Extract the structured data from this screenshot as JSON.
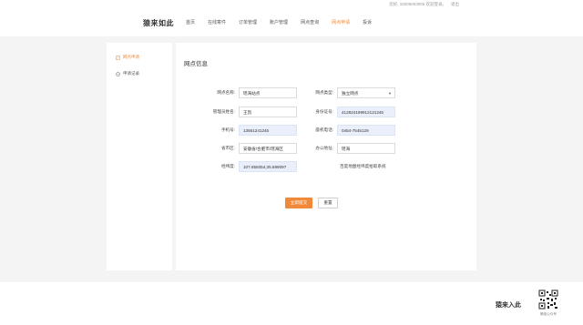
{
  "topbar": {
    "greeting": "您好, 15005003006 欢迎登录。",
    "logout": "退出"
  },
  "header": {
    "logo": "猿来如此",
    "nav": [
      {
        "label": "首页",
        "active": false
      },
      {
        "label": "在线寄件",
        "active": false
      },
      {
        "label": "订单管理",
        "active": false
      },
      {
        "label": "账户管理",
        "active": false
      },
      {
        "label": "网点查询",
        "active": false
      },
      {
        "label": "网点申请",
        "active": true
      },
      {
        "label": "投诉",
        "active": false
      }
    ]
  },
  "sidebar": {
    "items": [
      {
        "label": "网点申请",
        "icon": "edit-icon",
        "active": true
      },
      {
        "label": "申请记录",
        "icon": "check-circle-icon",
        "active": false
      }
    ]
  },
  "main": {
    "title": "网点信息",
    "fields": {
      "outlet_name": {
        "label": "网点名称:",
        "value": "瑶海站点"
      },
      "outlet_type": {
        "label": "网点类型:",
        "value": "独立网点"
      },
      "manager_name": {
        "label": "管理员姓名:",
        "value": "王凯"
      },
      "id_number": {
        "label": "身份证号:",
        "value": "412824199912121245"
      },
      "phone": {
        "label": "手机号:",
        "value": "13561241245"
      },
      "landline": {
        "label": "座机电话:",
        "value": "0454-7545129"
      },
      "region": {
        "label": "省市区:",
        "value": "安徽省/合肥市/瑶海区"
      },
      "office_address": {
        "label": "办公地址:",
        "value": "瑶海"
      },
      "coords": {
        "label": "经纬度:",
        "value": "107.655054,35.699097"
      },
      "coords_hint": "百度地图经纬度拾取系统"
    },
    "submit_label": "立即提交",
    "reset_label": "重置"
  },
  "footer": {
    "logo": "猿来入此",
    "qr_caption": "微信公众号"
  },
  "colors": {
    "accent": "#f08a3a",
    "filled_input": "#e9f0fb"
  }
}
